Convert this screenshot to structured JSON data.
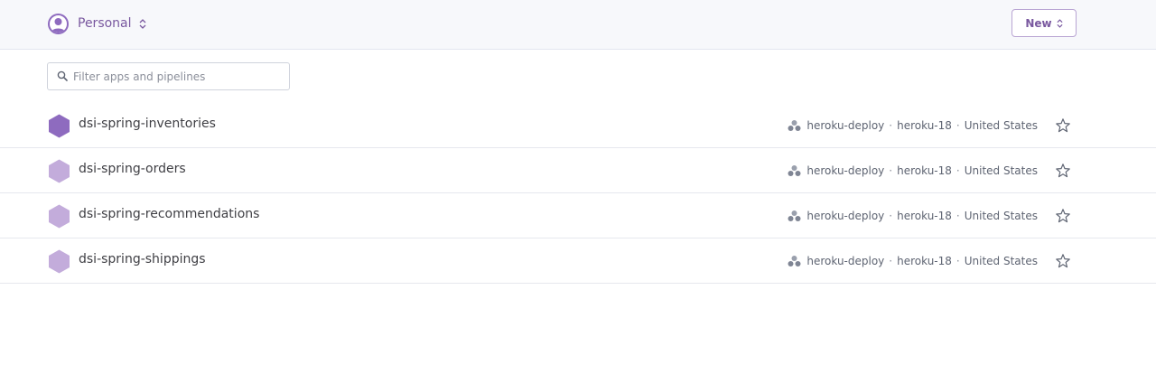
{
  "header": {
    "account_name": "Personal",
    "new_button_label": "New"
  },
  "search": {
    "placeholder": "Filter apps and pipelines",
    "value": ""
  },
  "apps": [
    {
      "name": "dsi-spring-inventories",
      "pipeline": "heroku-deploy",
      "stack": "heroku-18",
      "region": "United States",
      "icon": "app-hexagon-icon",
      "color": "#8e6bbf"
    },
    {
      "name": "dsi-spring-orders",
      "pipeline": "heroku-deploy",
      "stack": "heroku-18",
      "region": "United States",
      "icon": "app-hexagon-icon",
      "color": "#c3acdb"
    },
    {
      "name": "dsi-spring-recommendations",
      "pipeline": "heroku-deploy",
      "stack": "heroku-18",
      "region": "United States",
      "icon": "app-hexagon-icon",
      "color": "#c3acdb"
    },
    {
      "name": "dsi-spring-shippings",
      "pipeline": "heroku-deploy",
      "stack": "heroku-18",
      "region": "United States",
      "icon": "app-hexagon-icon",
      "color": "#c3acdb"
    }
  ],
  "separator": "·",
  "colors": {
    "brand": "#79589f",
    "header_bg": "#f7f8fb"
  }
}
